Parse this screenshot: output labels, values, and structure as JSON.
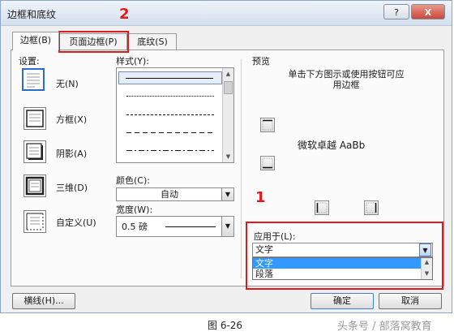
{
  "window": {
    "title": "边框和底纹",
    "help": "?",
    "close": "X"
  },
  "tabs": [
    {
      "label": "边框(B)"
    },
    {
      "label": "页面边框(P)"
    },
    {
      "label": "底纹(S)"
    }
  ],
  "settings": {
    "header": "设置:",
    "items": [
      {
        "label": "无(N)",
        "icon": "no-border-icon"
      },
      {
        "label": "方框(X)",
        "icon": "box-border-icon"
      },
      {
        "label": "阴影(A)",
        "icon": "shadow-border-icon"
      },
      {
        "label": "三维(D)",
        "icon": "3d-border-icon"
      },
      {
        "label": "自定义(U)",
        "icon": "custom-border-icon"
      }
    ]
  },
  "style": {
    "header": "样式(Y):"
  },
  "color": {
    "label": "颜色(C):",
    "value": "自动"
  },
  "width": {
    "label": "宽度(W):",
    "value": "0.5 磅"
  },
  "preview": {
    "header": "预览",
    "hint": "单击下方图示或使用按钮可应用边框",
    "sample_text": "微软卓越 AaBb"
  },
  "apply_to": {
    "label": "应用于(L):",
    "value": "文字",
    "options": [
      "文字",
      "段落"
    ]
  },
  "buttons": {
    "horizontal_line": "横线(H)...",
    "ok": "确定",
    "cancel": "取消"
  },
  "annotations": {
    "marker_1": "1",
    "marker_2": "2"
  },
  "caption": "图 6-26",
  "watermark": "头条号 / 部落窝教育"
}
